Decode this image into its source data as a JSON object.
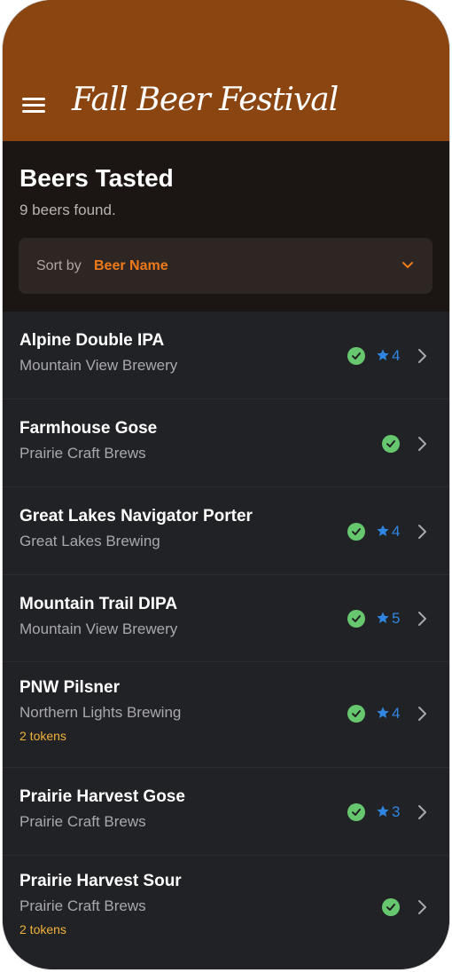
{
  "header": {
    "title": "Fall Beer Festival"
  },
  "page": {
    "title": "Beers Tasted",
    "count_text": "9 beers found."
  },
  "sort": {
    "label": "Sort by",
    "value": "Beer Name"
  },
  "colors": {
    "header_bg": "#8a4511",
    "accent": "#f07a1a",
    "check": "#67c76f",
    "star": "#2f86e2",
    "tokens": "#f1b23a"
  },
  "beers": [
    {
      "name": "Alpine Double IPA",
      "brewery": "Mountain View Brewery",
      "rating": "4",
      "tokens": ""
    },
    {
      "name": "Farmhouse Gose",
      "brewery": "Prairie Craft Brews",
      "rating": "",
      "tokens": ""
    },
    {
      "name": "Great Lakes Navigator Porter",
      "brewery": "Great Lakes Brewing",
      "rating": "4",
      "tokens": ""
    },
    {
      "name": "Mountain Trail DIPA",
      "brewery": "Mountain View Brewery",
      "rating": "5",
      "tokens": ""
    },
    {
      "name": "PNW Pilsner",
      "brewery": "Northern Lights Brewing",
      "rating": "4",
      "tokens": "2 tokens"
    },
    {
      "name": "Prairie Harvest Gose",
      "brewery": "Prairie Craft Brews",
      "rating": "3",
      "tokens": ""
    },
    {
      "name": "Prairie Harvest Sour",
      "brewery": "Prairie Craft Brews",
      "rating": "",
      "tokens": "2 tokens"
    }
  ]
}
